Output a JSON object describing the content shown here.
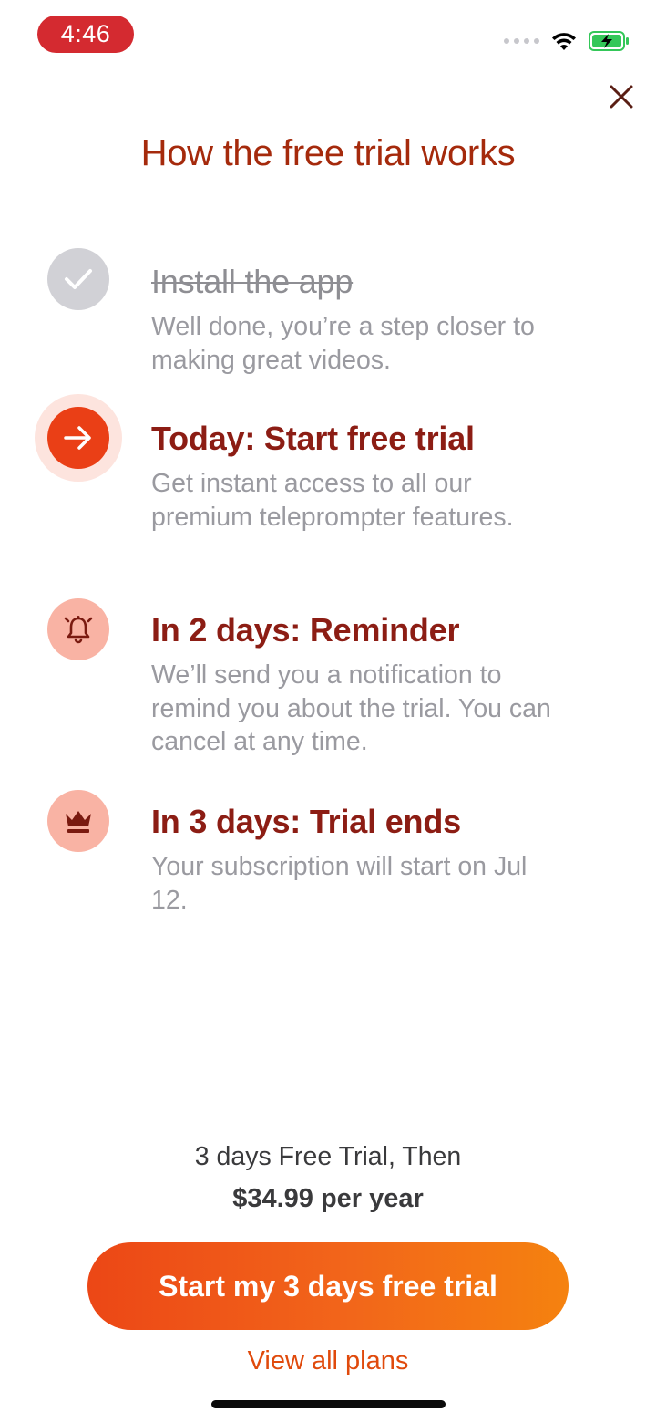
{
  "status_bar": {
    "time": "4:46"
  },
  "page": {
    "title": "How the free trial works"
  },
  "steps": [
    {
      "icon": "checkmark-icon",
      "title": "Install the app",
      "description": "Well done, you’re a step closer to making great videos.",
      "state": "completed"
    },
    {
      "icon": "arrow-right-icon",
      "title": "Today: Start free trial",
      "description": "Get instant access to all our premium teleprompter features.",
      "state": "current"
    },
    {
      "icon": "bell-icon",
      "title": "In 2 days: Reminder",
      "description": "We’ll send you a notification to remind you about the trial. You can cancel at any time.",
      "state": "upcoming"
    },
    {
      "icon": "crown-icon",
      "title": "In 3 days: Trial ends",
      "description": "Your subscription will start on Jul 12.",
      "state": "upcoming"
    }
  ],
  "offer": {
    "line1": "3 days Free Trial, Then",
    "price": "$34.99",
    "period": " per year"
  },
  "cta": {
    "label": "Start my 3 days free trial"
  },
  "links": {
    "view_all_plans": "View all plans"
  },
  "colors": {
    "title": "#a52a0c",
    "step_title": "#8c1d14",
    "accent": "#e8401a",
    "status_time_bg": "#d42a30",
    "icon_soft_bg": "#f9b3a4",
    "battery": "#34c759"
  }
}
